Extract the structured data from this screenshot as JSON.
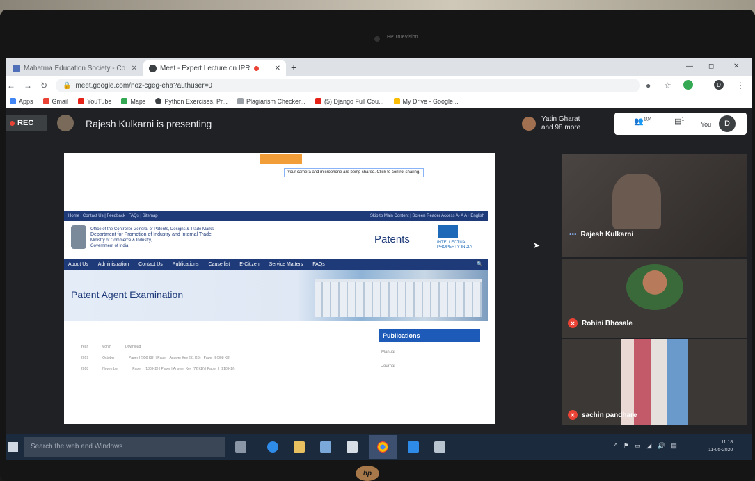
{
  "browser": {
    "tabs": [
      {
        "label": "Mahatma Education Society - Co",
        "active": false
      },
      {
        "label": "Meet - Expert Lecture on IPR",
        "active": true
      }
    ],
    "new_tab": "+",
    "url": "meet.google.com/noz-cgeg-eha?authuser=0",
    "profile_initial": "D",
    "bookmarks": [
      "Apps",
      "Gmail",
      "YouTube",
      "Maps",
      "Python Exercises, Pr...",
      "Plagiarism Checker...",
      "(5) Django Full Cou...",
      "My Drive - Google..."
    ]
  },
  "meet": {
    "rec_label": "REC",
    "presenting_text": "Rajesh Kulkarni is presenting",
    "others_line1": "Yatin Gharat",
    "others_line2": "and 98 more",
    "participant_count": "104",
    "chat_badge": "1",
    "you_label": "You",
    "you_initial": "D",
    "participants": [
      {
        "name": "Rajesh Kulkarni"
      },
      {
        "name": "Rohini Bhosale"
      },
      {
        "name": "sachin pandhare"
      }
    ]
  },
  "shared_page": {
    "notice": "Your camera and microphone are being shared. Click to control sharing.",
    "topnav_left": "Home | Contact Us | Feedback | FAQs | Sitemap",
    "topnav_right": "Skip to Main Content | Screen Reader Access  A- A A+  English",
    "office_line1": "Office of the Controller General of Patents, Designs & Trade Marks",
    "office_line2": "Department for Promotion of Industry and Internal Trade",
    "office_line3": "Ministry of Commerce & Industry,",
    "office_line4": "Government of India",
    "site_title": "Patents",
    "ipi_line1": "INTELLECTUAL",
    "ipi_line2": "PROPERTY INDIA",
    "menu": [
      "About Us",
      "Administration",
      "Contact Us",
      "Publications",
      "Cause list",
      "E-Citizen",
      "Service Matters",
      "FAQs"
    ],
    "banner_title": "Patent Agent Examination",
    "publications_heading": "Publications",
    "publications_items": [
      "Manual",
      "Journal"
    ],
    "table_headers": [
      "Year",
      "Month",
      "Download"
    ],
    "table_rows": [
      [
        "2019",
        "October",
        "Paper I (950 KB) | Paper I Answer Key (31 KB) | Paper II (808 KB)"
      ],
      [
        "2018",
        "November",
        "Paper I (180 KB) | Paper I Answer Key (72 KB) | Paper II (210 KB)"
      ]
    ]
  },
  "taskbar": {
    "search_placeholder": "Search the web and Windows",
    "time": "11:18",
    "date": "11-05-2020"
  },
  "hardware": {
    "brand": "hp",
    "webcam_label": "HP TrueVision"
  }
}
